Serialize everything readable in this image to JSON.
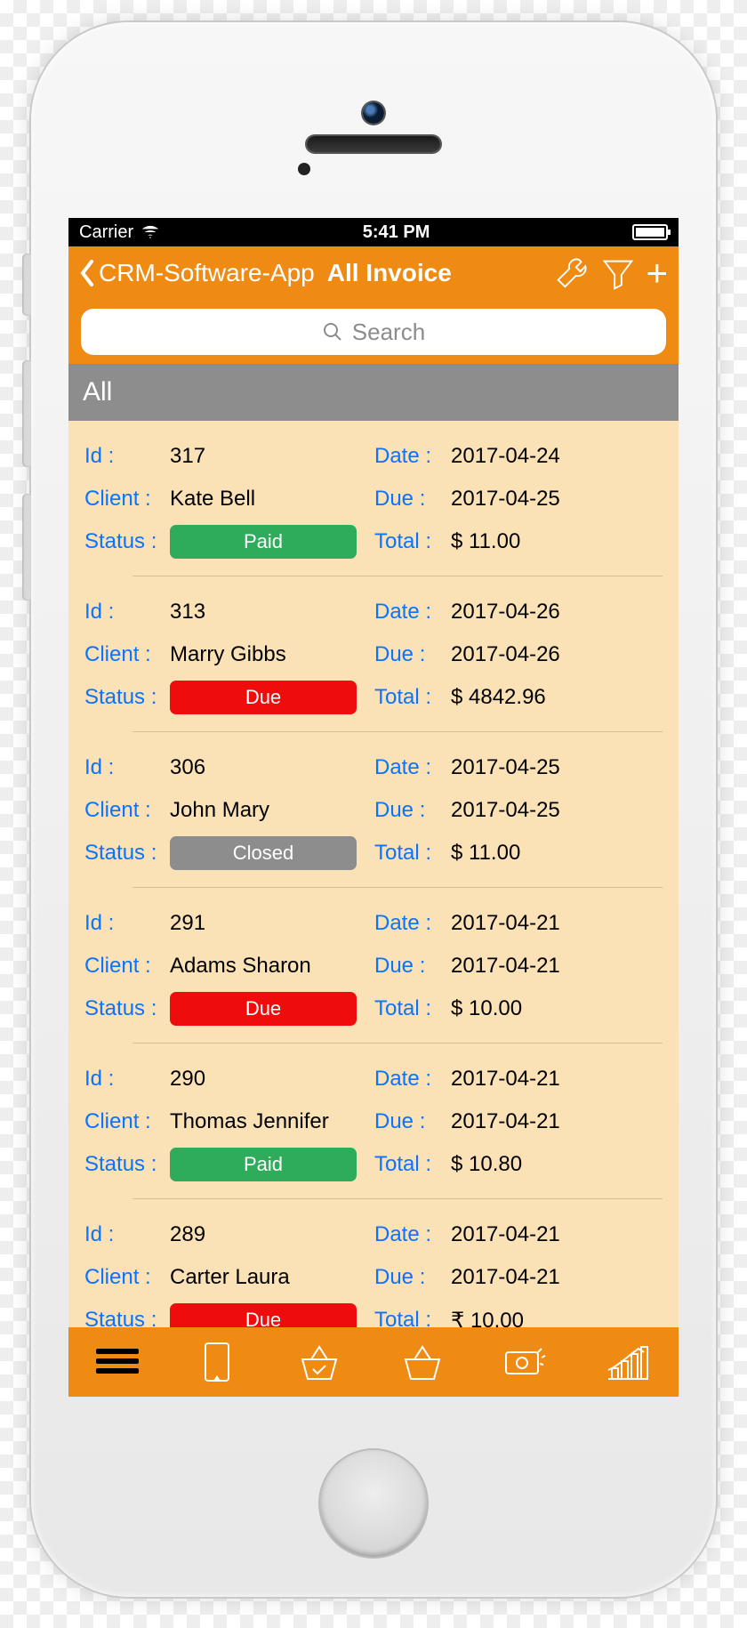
{
  "statusbar": {
    "carrier": "Carrier",
    "time": "5:41 PM"
  },
  "navbar": {
    "back": "CRM-Software-App",
    "title": "All Invoice"
  },
  "search": {
    "placeholder": "Search"
  },
  "section": "All",
  "labels": {
    "id": "Id :",
    "client": "Client :",
    "status": "Status :",
    "date": "Date :",
    "due": "Due :",
    "total": "Total :"
  },
  "status_styles": {
    "Paid": "b-paid",
    "Due": "b-due",
    "Closed": "b-closed"
  },
  "invoices": [
    {
      "id": "317",
      "client": "Kate Bell",
      "status": "Paid",
      "date": "2017-04-24",
      "due": "2017-04-25",
      "total": "$ 11.00"
    },
    {
      "id": "313",
      "client": "Marry Gibbs",
      "status": "Due",
      "date": "2017-04-26",
      "due": "2017-04-26",
      "total": "$ 4842.96"
    },
    {
      "id": "306",
      "client": "John Mary",
      "status": "Closed",
      "date": "2017-04-25",
      "due": "2017-04-25",
      "total": "$ 11.00"
    },
    {
      "id": "291",
      "client": "Adams Sharon",
      "status": "Due",
      "date": "2017-04-21",
      "due": "2017-04-21",
      "total": "$ 10.00"
    },
    {
      "id": "290",
      "client": "Thomas Jennifer",
      "status": "Paid",
      "date": "2017-04-21",
      "due": "2017-04-21",
      "total": "$ 10.80"
    },
    {
      "id": "289",
      "client": "Carter Laura",
      "status": "Due",
      "date": "2017-04-21",
      "due": "2017-04-21",
      "total": "₹ 10.00"
    }
  ]
}
